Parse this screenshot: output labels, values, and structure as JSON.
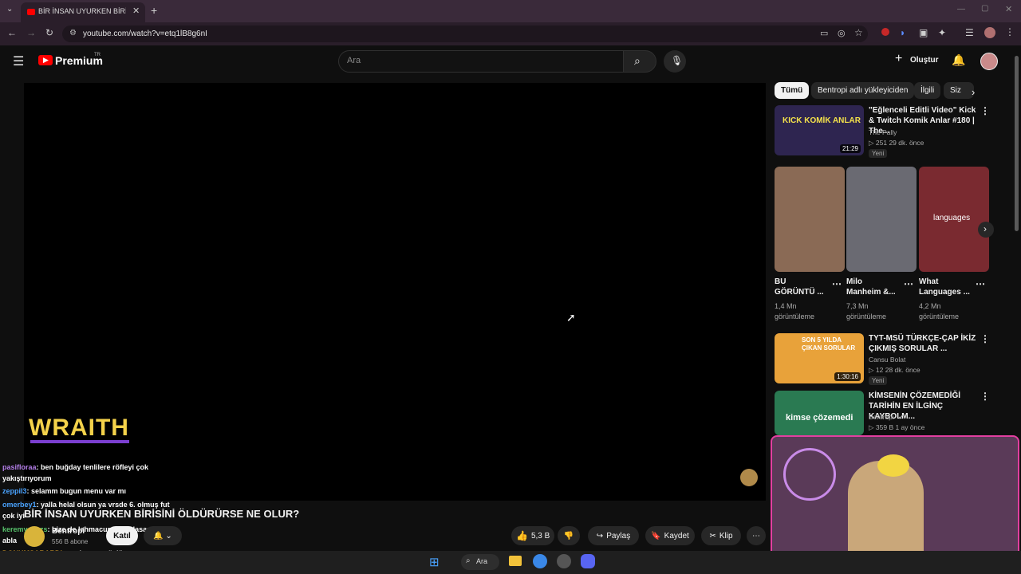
{
  "browser": {
    "tab_title": "BİR İNSAN UYURKEN BİRİSİNİ Ö",
    "url": "youtube.com/watch?v=etq1lB8g6nI"
  },
  "header": {
    "logo_text": "Premium",
    "logo_region": "TR",
    "search_placeholder": "Ara",
    "create_label": "Oluştur"
  },
  "player": {
    "overlay_logo": "WRAITH"
  },
  "chat": [
    {
      "user": "pasifloraa",
      "user_color": "#b37ee8",
      "message": ": ben buğday tenlilere röfleyi çok"
    },
    {
      "user": "",
      "user_color": "#ffffff",
      "message": "yakıştırıyorum"
    },
    {
      "user": "zeppil3",
      "user_color": "#4aa3ff",
      "message": ": selamm bugun menu var mı"
    },
    {
      "user": "omerbey1",
      "user_color": "#4aa3ff",
      "message": ": yalla helal olsun ya vrsde 6. olmuş fut"
    },
    {
      "user": "",
      "user_color": "#ffffff",
      "message": "çok iyi"
    },
    {
      "user": "keremyavuzs",
      "user_color": "#56c16a",
      "message": ": bize de lahmacun ısmarlasana"
    },
    {
      "user": "",
      "user_color": "#ffffff",
      "message": "abla"
    },
    {
      "user": "DONUMSARARDI",
      "user_color": "#f0b030",
      "message": ": var burger söylüyoz"
    },
    {
      "user": "tinitaVolkan",
      "user_color": "#b37ee8",
      "message": ": enişteye selam"
    }
  ],
  "video": {
    "title": "BİR İNSAN UYURKEN BİRİSİNİ ÖLDÜRÜRSE NE OLUR?",
    "channel": "Bentropi",
    "subscribers": "556 B abone",
    "join_label": "Katıl",
    "likes": "5,3 B",
    "share_label": "Paylaş",
    "save_label": "Kaydet",
    "clip_label": "Klip"
  },
  "sidebar": {
    "chips": [
      "Tümü",
      "Bentropi adlı yükleyiciden",
      "İlgili",
      "Siz"
    ],
    "videos_top": [
      {
        "title": "\"Eğlenceli Editli Video\" Kick & Twitch Komik Anlar #180 | The...",
        "channel": "The Pally",
        "meta": "▷ 251  29 dk. önce",
        "badge": "Yeni",
        "duration": "21:29",
        "thumb_text": "KICK KOMİK ANLAR"
      }
    ],
    "shorts": [
      {
        "title": "BU GÖRÜNTÜ ...",
        "views": "1,4 Mn görüntüleme"
      },
      {
        "title": "Milo Manheim &...",
        "views": "7,3 Mn görüntüleme"
      },
      {
        "title": "What Languages ...",
        "views": "4,2 Mn görüntüleme",
        "thumb_text": "languages"
      }
    ],
    "videos_bottom": [
      {
        "title": "TYT-MSÜ TÜRKÇE-ÇAP İKİZ ÇIKMIŞ SORULAR ...",
        "channel": "Cansu Bolat",
        "meta": "▷ 12  28 dk. önce",
        "badge": "Yeni",
        "duration": "1:30:16",
        "thumb_text": "SON 5 YILDA ÇIKAN SORULAR"
      },
      {
        "title": "KİMSENİN ÇÖZEMEDİĞİ TARİHİN EN İLGİNÇ KAYBOLM...",
        "channel": "Bentropi",
        "meta": "▷ 359 B  1 ay önce",
        "badge": "",
        "duration": "17:02",
        "thumb_text": "kimse çözemedi"
      }
    ]
  },
  "taskbar": {
    "search_label": "Ara"
  },
  "colors": {
    "accent_red": "#ff0000",
    "webcam_border": "#e23fa0"
  }
}
